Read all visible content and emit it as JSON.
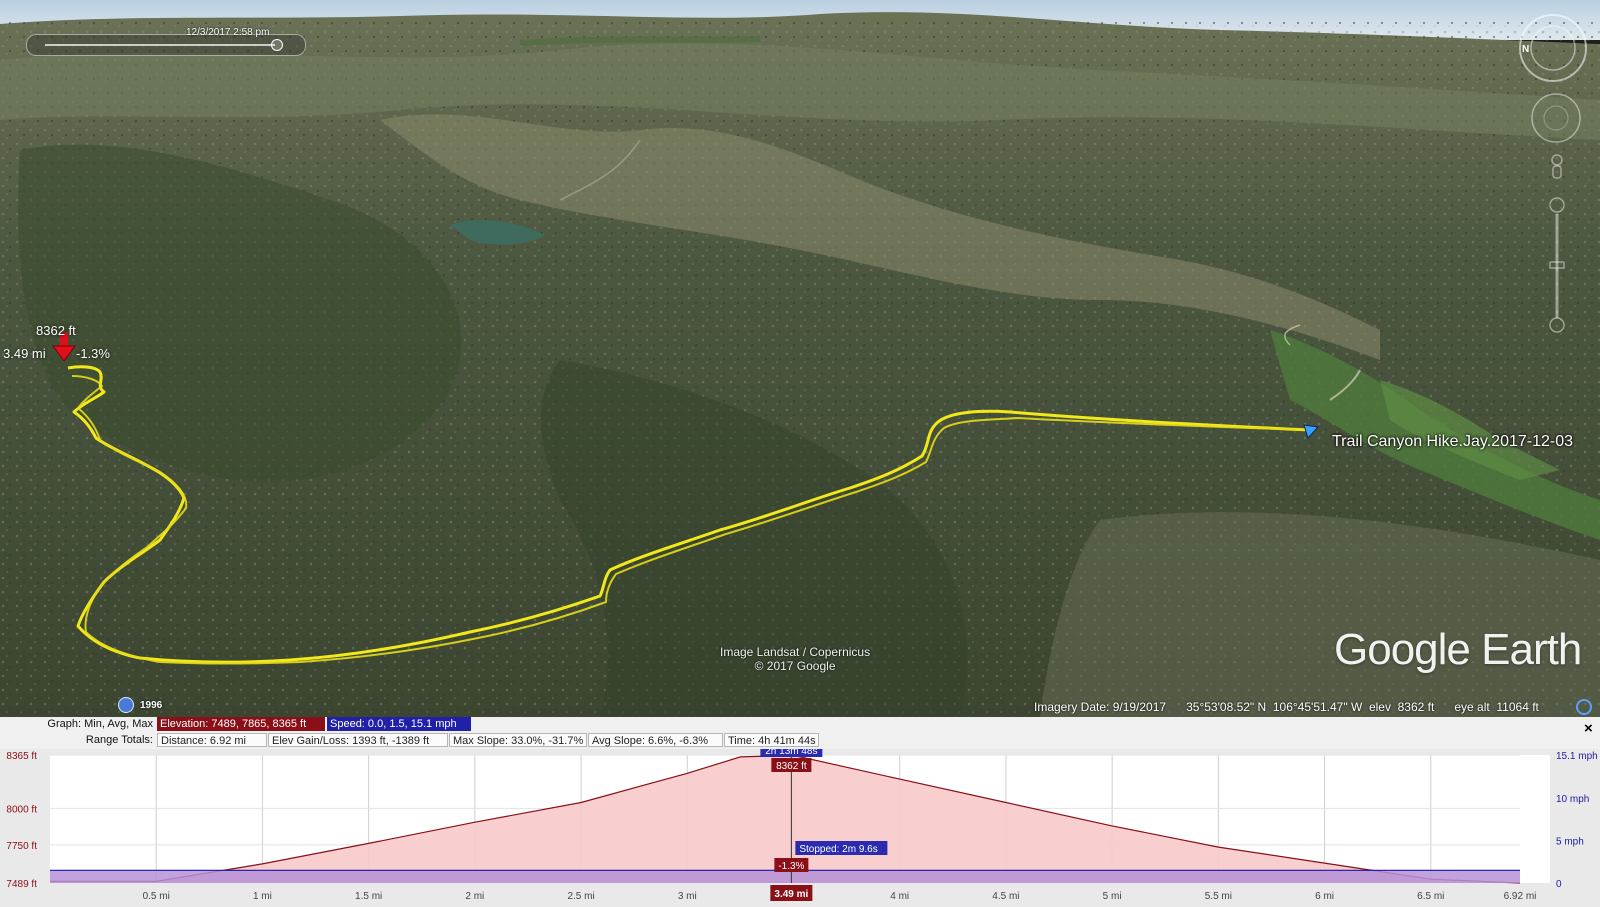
{
  "map": {
    "timestamp": "12/3/2017   2:58 pm",
    "compass_letter": "N",
    "track_name": "Trail Canyon Hike.Jay.2017-12-03",
    "pointer": {
      "elevation": "8362 ft",
      "distance": "3.49 mi",
      "slope": "-1.3%"
    },
    "attribution_line1": "Image Landsat / Copernicus",
    "attribution_line2": "© 2017 Google",
    "logo_google": "Google",
    "logo_earth": "Earth",
    "historical_year": "1996",
    "status": {
      "imagery_date": "Imagery Date: 9/19/2017",
      "lat": "35°53'08.52\" N",
      "lon": "106°45'51.47\" W",
      "elev": "elev  8362 ft",
      "eye_alt": "eye alt  11064 ft"
    },
    "colors": {
      "track": "#f2e81a",
      "pointer": "#e0101a"
    }
  },
  "profile": {
    "graph_label": "Graph: Min, Avg, Max",
    "range_label": "Range Totals:",
    "elevation_stats": "Elevation: 7489, 7865, 8365 ft",
    "speed_stats": "Speed: 0.0, 1.5, 15.1 mph",
    "distance": "Distance: 6.92 mi",
    "elev_gain_loss": "Elev Gain/Loss: 1393 ft, -1389 ft",
    "max_slope": "Max Slope: 33.0%, -31.7%",
    "avg_slope": "Avg Slope: 6.6%, -6.3%",
    "time": "Time: 4h 41m 44s",
    "close_label": "×",
    "cursor_time": "2h 13m 48s",
    "cursor_elev": "8362 ft",
    "cursor_slope": "-1.3%",
    "cursor_distance": "3.49 mi",
    "stopped_label": "Stopped: 2m 9.6s",
    "colors": {
      "elevation_fill": "#f7c9c9",
      "elevation_line": "#8a0f16",
      "speed_fill": "#b690d8",
      "speed_line": "#1818a0"
    }
  },
  "chart_data": {
    "type": "area",
    "x_unit": "mi",
    "xlim": [
      0,
      6.92
    ],
    "x_ticks": [
      "0.5 mi",
      "1 mi",
      "1.5 mi",
      "2 mi",
      "2.5 mi",
      "3 mi",
      "3.5 mi",
      "4 mi",
      "4.5 mi",
      "5 mi",
      "5.5 mi",
      "6 mi",
      "6.5 mi",
      "6.92 mi"
    ],
    "x_tick_values": [
      0.5,
      1,
      1.5,
      2,
      2.5,
      3,
      3.5,
      4,
      4.5,
      5,
      5.5,
      6,
      6.5,
      6.92
    ],
    "y_left_ticks": [
      "8365 ft",
      "8000 ft",
      "7750 ft",
      "7489 ft"
    ],
    "y_left_tick_values": [
      8365,
      8000,
      7750,
      7489
    ],
    "y_right_ticks": [
      "15.1 mph",
      "10 mph",
      "5 mph",
      "0"
    ],
    "y_right_tick_values": [
      15.1,
      10,
      5,
      0
    ],
    "ylim_left": [
      7489,
      8365
    ],
    "ylim_right": [
      0,
      15.1
    ],
    "cursor_x": 3.49,
    "series": [
      {
        "axis": "left",
        "x": [
          0,
          0.5,
          1,
          1.5,
          2,
          2.5,
          3,
          3.25,
          3.5,
          4,
          4.5,
          5,
          5.5,
          6,
          6.5,
          6.92
        ],
        "values": [
          7500,
          7500,
          7620,
          7760,
          7905,
          8040,
          8240,
          8352,
          8362,
          8200,
          8040,
          7880,
          7735,
          7625,
          7515,
          7489
        ]
      },
      {
        "axis": "right",
        "x": [
          0,
          6.92
        ],
        "values": [
          1.5,
          1.5
        ]
      }
    ]
  }
}
